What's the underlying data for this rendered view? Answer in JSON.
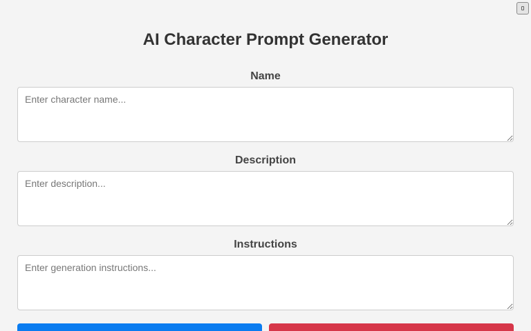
{
  "app": {
    "title": "AI Character Prompt Generator"
  },
  "corner_button": {
    "icon": "copy-icon"
  },
  "fields": [
    {
      "label": "Name",
      "value": "",
      "placeholder": "Enter character name..."
    },
    {
      "label": "Description",
      "value": "",
      "placeholder": "Enter description..."
    },
    {
      "label": "Instructions",
      "value": "",
      "placeholder": "Enter generation instructions..."
    }
  ],
  "actions": {
    "primary_color": "#0a7cf0",
    "danger_color": "#d63649"
  }
}
